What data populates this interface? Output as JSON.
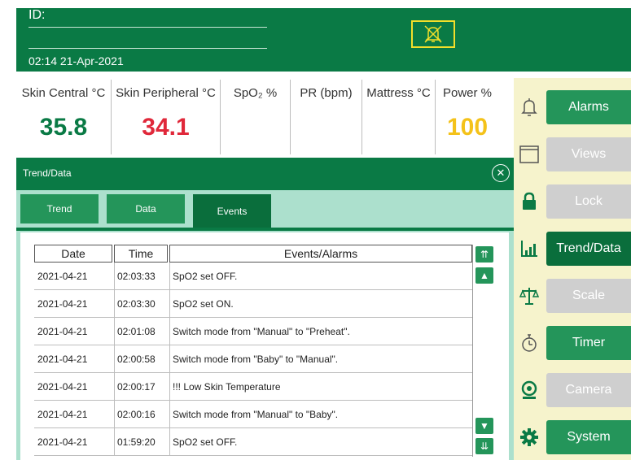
{
  "header": {
    "id_label": "ID:",
    "datetime": "02:14 21-Apr-2021"
  },
  "vitals": [
    {
      "label": "Skin Central °C",
      "value": "35.8",
      "color": "#0a7a45"
    },
    {
      "label": "Skin Peripheral °C",
      "value": "34.1",
      "color": "#e0283a"
    },
    {
      "label": "SpO₂ %",
      "value": "",
      "color": "#0a7a45"
    },
    {
      "label": "PR (bpm)",
      "value": "",
      "color": "#0a7a45"
    },
    {
      "label": "Mattress °C",
      "value": "",
      "color": "#0a7a45"
    },
    {
      "label": "Power %",
      "value": "100",
      "color": "#f4c21a"
    }
  ],
  "side_menu": [
    {
      "label": "Alarms",
      "icon": "bell-icon",
      "state": "on"
    },
    {
      "label": "Views",
      "icon": "window-icon",
      "state": "off"
    },
    {
      "label": "Lock",
      "icon": "lock-icon",
      "state": "off"
    },
    {
      "label": "Trend/Data",
      "icon": "bar-chart-icon",
      "state": "active"
    },
    {
      "label": "Scale",
      "icon": "scale-icon",
      "state": "off"
    },
    {
      "label": "Timer",
      "icon": "stopwatch-icon",
      "state": "on"
    },
    {
      "label": "Camera",
      "icon": "camera-icon",
      "state": "off"
    },
    {
      "label": "System",
      "icon": "gear-icon",
      "state": "on"
    }
  ],
  "panel": {
    "title": "Trend/Data",
    "tabs": [
      "Trend",
      "Data",
      "Events"
    ],
    "active_tab": "Events"
  },
  "table": {
    "headers": [
      "Date",
      "Time",
      "Events/Alarms"
    ],
    "rows": [
      [
        "2021-04-21",
        "02:03:33",
        "SpO2 set OFF."
      ],
      [
        "2021-04-21",
        "02:03:30",
        "SpO2 set ON."
      ],
      [
        "2021-04-21",
        "02:01:08",
        "Switch mode from \"Manual\" to \"Preheat\"."
      ],
      [
        "2021-04-21",
        "02:00:58",
        "Switch mode from \"Baby\" to \"Manual\"."
      ],
      [
        "2021-04-21",
        "02:00:17",
        "!!! Low Skin Temperature"
      ],
      [
        "2021-04-21",
        "02:00:16",
        "Switch mode from \"Manual\" to \"Baby\"."
      ],
      [
        "2021-04-21",
        "01:59:20",
        "SpO2 set OFF."
      ]
    ]
  },
  "colors": {
    "brand_green": "#0a7a45",
    "button_green": "#24955a",
    "active_green": "#0a6e3c",
    "disabled_gray": "#cfcfcf",
    "side_bg": "#f6f3cc",
    "alarm_yellow": "#f3df2a"
  }
}
